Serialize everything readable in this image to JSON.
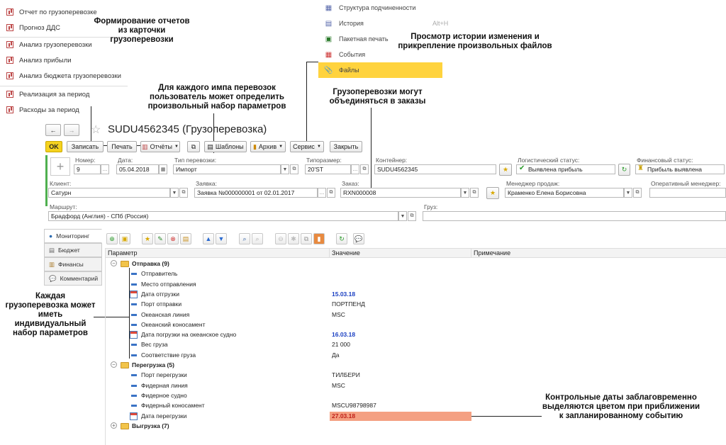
{
  "left_menu": {
    "items": [
      "Отчет по грузоперевозке",
      "Прогноз ДДС",
      "Анализ грузоперевозки",
      "Анализ прибыли",
      "Анализ бюджета грузоперевозки",
      "Реализация за период",
      "Расходы за период"
    ]
  },
  "right_menu": {
    "items": [
      {
        "label": "Структура подчиненности",
        "shortcut": ""
      },
      {
        "label": "История",
        "shortcut": "Alt+H"
      },
      {
        "label": "Пакетная печать",
        "shortcut": ""
      },
      {
        "label": "События",
        "shortcut": ""
      },
      {
        "label": "Файлы",
        "shortcut": ""
      }
    ]
  },
  "annotations": {
    "reports": "Формирование отчетов из карточки грузоперевозки",
    "history": "Просмотр истории изменения и прикрепление произвольных файлов",
    "params_set": "Для каждого импа перевозок пользователь может определить произвольный набор параметров",
    "orders": "Грузоперевозки могут объединяться в заказы",
    "individual": "Каждая грузоперевозка может иметь индивидуальный набор параметров",
    "control_dates": "Контрольные даты заблаговременно выделяются цветом при приближении к запланированному событию"
  },
  "window": {
    "title": "SUDU4562345 (Грузоперевозка)"
  },
  "toolbar": {
    "ok": "OK",
    "save": "Записать",
    "print": "Печать",
    "reports": "Отчёты",
    "templates": "Шаблоны",
    "archive": "Архив",
    "service": "Сервис",
    "close": "Закрыть"
  },
  "form": {
    "number_label": "Номер:",
    "number": "9",
    "date_label": "Дата:",
    "date": "05.04.2018",
    "type_label": "Тип перевозки:",
    "type": "Импорт",
    "size_label": "Типоразмер:",
    "size": "20'ST",
    "container_label": "Контейнер:",
    "container": "SUDU4562345",
    "log_status_label": "Логистический статус:",
    "log_status": "Выявлена прибыль",
    "fin_status_label": "Финансовый статус:",
    "fin_status": "Прибыль выявлена",
    "client_label": "Клиент:",
    "client": "Сатурн",
    "request_label": "Заявка:",
    "request": "Заявка №000000001 от 02.01.2017",
    "order_label": "Заказ:",
    "order": "RXN000008",
    "manager_label": "Менеджер продаж:",
    "manager": "Краменко Елена Борисовна",
    "op_manager_label": "Оперативный менеджер:",
    "op_manager": "",
    "route_label": "Маршрут:",
    "route": "Брадфорд (Англия) - СПб (Россия)",
    "cargo_label": "Груз:",
    "cargo": ""
  },
  "tabs": [
    "Мониторинг",
    "Бюджет",
    "Финансы",
    "Комментарий"
  ],
  "table": {
    "headers": [
      "Параметр",
      "Значение",
      "Примечание"
    ],
    "rows": [
      {
        "name": "Отправка (9)",
        "value": "",
        "group": true
      },
      {
        "name": "Отправитель",
        "value": ""
      },
      {
        "name": "Место отправления",
        "value": ""
      },
      {
        "name": "Дата отгрузки",
        "value": "15.03.18",
        "date": true
      },
      {
        "name": "Порт отправки",
        "value": "ПОРТПЕНД"
      },
      {
        "name": "Океанская линия",
        "value": "MSC"
      },
      {
        "name": "Океанский коносамент",
        "value": ""
      },
      {
        "name": "Дата погрузки на океанское судно",
        "value": "16.03.18",
        "date": true
      },
      {
        "name": "Вес груза",
        "value": "21 000"
      },
      {
        "name": "Соответствие груза",
        "value": "Да"
      },
      {
        "name": "Перегрузка (5)",
        "value": "",
        "group": true
      },
      {
        "name": "Порт перегрузки",
        "value": "ТИЛБЕРИ"
      },
      {
        "name": "Фидерная линия",
        "value": "MSC"
      },
      {
        "name": "Фидерное судно",
        "value": ""
      },
      {
        "name": "Фидерный коносамент",
        "value": "MSCU98798987"
      },
      {
        "name": "Дата перегрузки",
        "value": "27.03.18",
        "date": true,
        "highlight": true
      },
      {
        "name": "Выгрузка (7)",
        "value": "",
        "group": true,
        "collapsed": true
      }
    ]
  },
  "colors": {
    "ok_button": "#f5d21f",
    "selected_menu": "#ffd33e",
    "date_blue": "#1a3fc2",
    "highlight": "#f4a082",
    "date_red": "#c0201a"
  }
}
